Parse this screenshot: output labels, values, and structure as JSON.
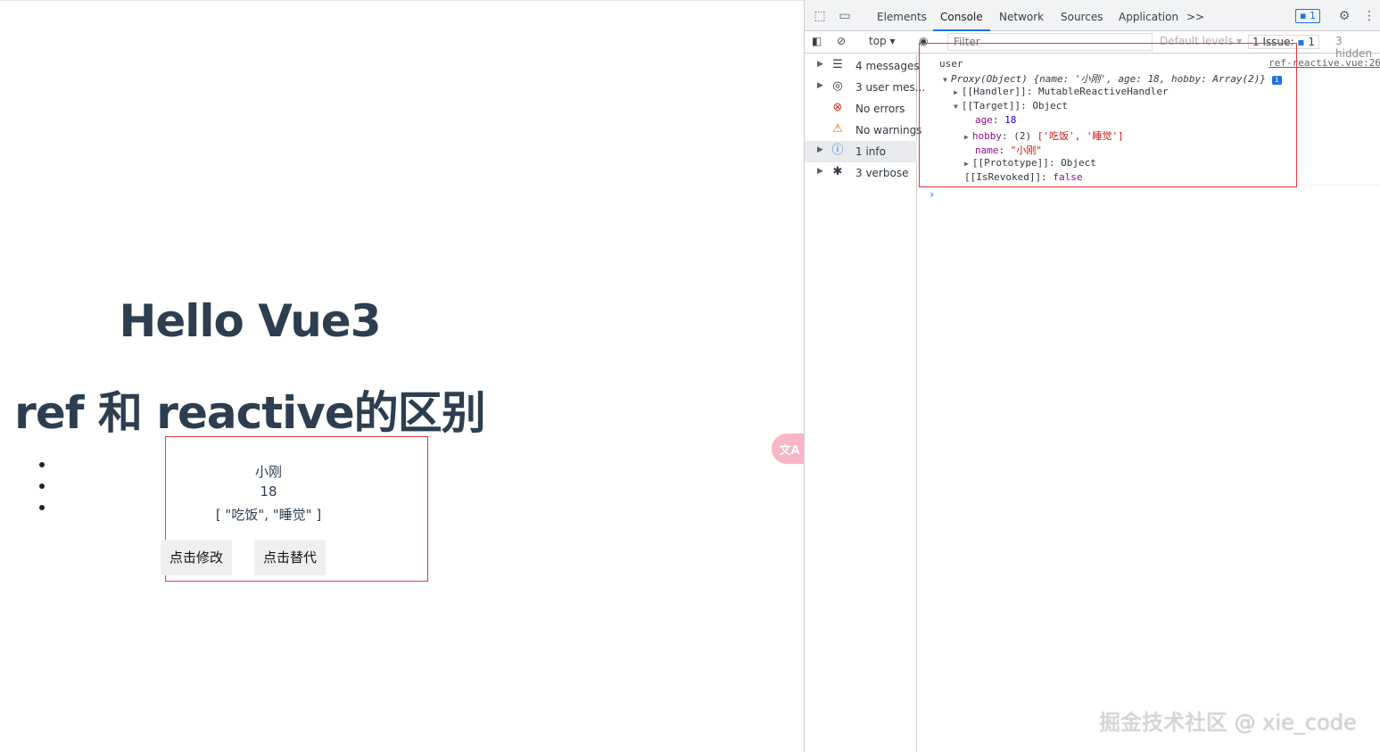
{
  "page": {
    "title1": "Hello Vue3",
    "title2": "ref 和 reactive的区别",
    "items": [
      "小刚",
      "18",
      "[ \"吃饭\", \"睡觉\" ]"
    ],
    "buttons": [
      "点击修改",
      "点击替代"
    ],
    "translate_label": "文A"
  },
  "devtools": {
    "tabs": [
      "Elements",
      "Console",
      "Network",
      "Sources",
      "Application"
    ],
    "active_tab": "Console",
    "more_tabs": ">>",
    "messages_badge": "1",
    "context": "top",
    "filter_placeholder": "Filter",
    "levels": "Default levels",
    "issues_label": "1 Issue:",
    "issues_count": "1",
    "hidden_label": "3 hidden",
    "sidebar": [
      {
        "label": "4 messages",
        "icon": "list-icon"
      },
      {
        "label": "3 user mes...",
        "icon": "user-icon"
      },
      {
        "label": "No errors",
        "icon": "error-icon"
      },
      {
        "label": "No warnings",
        "icon": "warning-icon"
      },
      {
        "label": "1 info",
        "icon": "info-icon"
      },
      {
        "label": "3 verbose",
        "icon": "bug-icon"
      }
    ],
    "log": {
      "label": "user",
      "source": "ref-reactive.vue:26",
      "proxy_head": "Proxy(Object)",
      "proxy_summary": "{name: '小刚', age: 18, hobby: Array(2)}",
      "handler_key": "[[Handler]]",
      "handler_val": "MutableReactiveHandler",
      "target_key": "[[Target]]",
      "target_val": "Object",
      "age_key": "age",
      "age_val": "18",
      "hobby_key": "hobby",
      "hobby_len": "(2)",
      "hobby_val": "['吃饭', '睡觉']",
      "name_key": "name",
      "name_val": "\"小刚\"",
      "proto_key": "[[Prototype]]",
      "proto_val": "Object",
      "revoked_key": "[[IsRevoked]]",
      "revoked_val": "false"
    }
  },
  "watermark": "掘金技术社区 @ xie_code"
}
